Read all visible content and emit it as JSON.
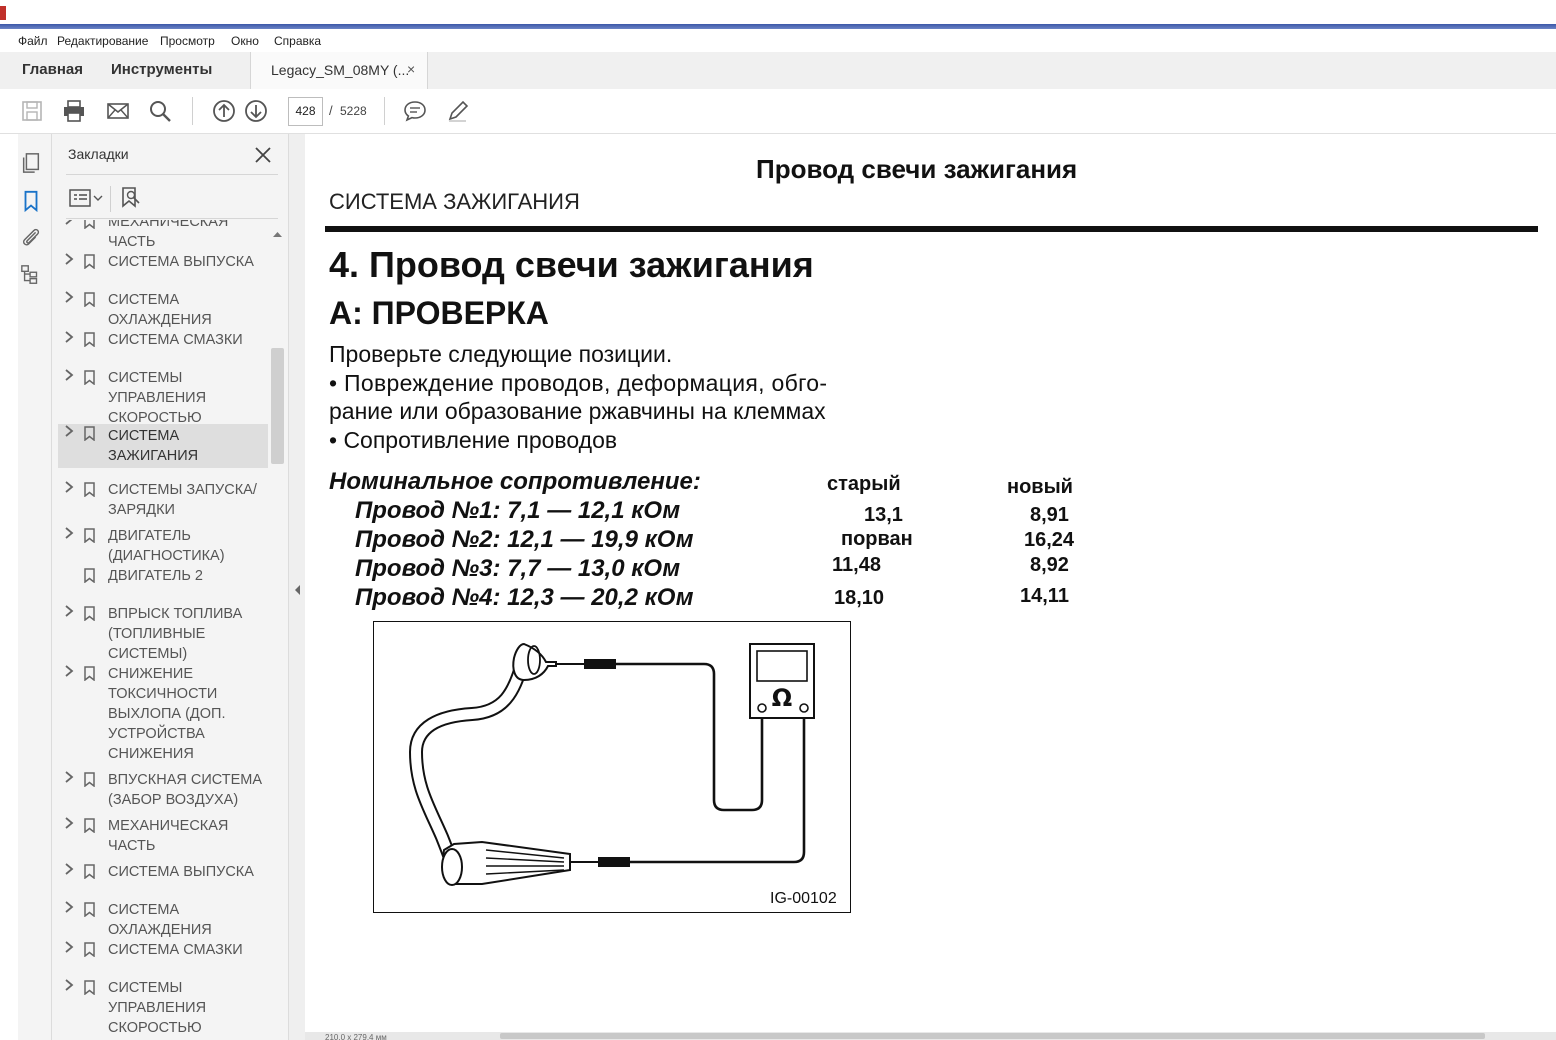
{
  "menu": [
    "Файл",
    "Редактирование",
    "Просмотр",
    "Окно",
    "Справка"
  ],
  "tabs": {
    "home": "Главная",
    "tools": "Инструменты",
    "document": "Legacy_SM_08MY (...",
    "close": "×"
  },
  "toolbar": {
    "page_current": "428",
    "page_sep": "/",
    "page_total": "5228"
  },
  "bookmarks": {
    "title": "Закладки",
    "items": [
      {
        "label": "МЕХАНИЧЕСКАЯ ЧАСТЬ",
        "has_children": true,
        "selected": false
      },
      {
        "label": "СИСТЕМА ВЫПУСКА",
        "has_children": true,
        "selected": false
      },
      {
        "label": "СИСТЕМА ОХЛАЖДЕНИЯ",
        "has_children": true,
        "selected": false
      },
      {
        "label": "СИСТЕМА СМАЗКИ",
        "has_children": true,
        "selected": false
      },
      {
        "label": "СИСТЕМЫ УПРАВЛЕНИЯ СКОРОСТЬЮ",
        "has_children": true,
        "selected": false
      },
      {
        "label": "СИСТЕМА ЗАЖИГАНИЯ",
        "has_children": true,
        "selected": true
      },
      {
        "label": "СИСТЕМЫ ЗАПУСКА/ЗАРЯДКИ",
        "has_children": true,
        "selected": false
      },
      {
        "label": "ДВИГАТЕЛЬ (ДИАГНОСТИКА)",
        "has_children": true,
        "selected": false
      },
      {
        "label": "ДВИГАТЕЛЬ 2",
        "has_children": false,
        "selected": false
      },
      {
        "label": "ВПРЫСК ТОПЛИВА (ТОПЛИВНЫЕ СИСТЕМЫ)",
        "has_children": true,
        "selected": false
      },
      {
        "label": "СНИЖЕНИЕ ТОКСИЧНОСТИ ВЫХЛОПА (ДОП. УСТРОЙСТВА СНИЖЕНИЯ",
        "has_children": true,
        "selected": false
      },
      {
        "label": "ВПУСКНАЯ СИСТЕМА (ЗАБОР ВОЗДУХА)",
        "has_children": true,
        "selected": false
      },
      {
        "label": "МЕХАНИЧЕСКАЯ ЧАСТЬ",
        "has_children": true,
        "selected": false
      },
      {
        "label": "СИСТЕМА ВЫПУСКА",
        "has_children": true,
        "selected": false
      },
      {
        "label": "СИСТЕМА ОХЛАЖДЕНИЯ",
        "has_children": true,
        "selected": false
      },
      {
        "label": "СИСТЕМА СМАЗКИ",
        "has_children": true,
        "selected": false
      },
      {
        "label": "СИСТЕМЫ УПРАВЛЕНИЯ СКОРОСТЬЮ",
        "has_children": true,
        "selected": false
      }
    ]
  },
  "document": {
    "page_header": "Провод свечи зажигания",
    "section": "СИСТЕМА ЗАЖИГАНИЯ",
    "heading": "4.  Провод свечи зажигания",
    "subheading": "A:  ПРОВЕРКА",
    "intro": "Проверьте следующие позиции.",
    "bullet1_line1": "•  Повреждение проводов, деформация, обго-",
    "bullet1_line2": "рание или образование ржавчины на клеммах",
    "bullet2": "•  Сопротивление проводов",
    "nominal_label": "Номинальное сопротивление:",
    "col_old": "старый",
    "col_new": "новый",
    "wires": [
      {
        "spec": "Провод №1: 7,1 — 12,1 кОм",
        "old": "13,1",
        "new": "8,91"
      },
      {
        "spec": "Провод №2: 12,1 — 19,9 кОм",
        "old": "порван",
        "new": "16,24"
      },
      {
        "spec": "Провод №3: 7,7 — 13,0 кОм",
        "old": "11,48",
        "new": "8,92"
      },
      {
        "spec": "Провод №4: 12,3 — 20,2 кОм",
        "old": "18,10",
        "new": "14,11"
      }
    ],
    "figure_code": "IG-00102",
    "ohm_symbol": "Ω"
  },
  "statusbar": {
    "page_size": "210,0 x 279,4 мм"
  }
}
